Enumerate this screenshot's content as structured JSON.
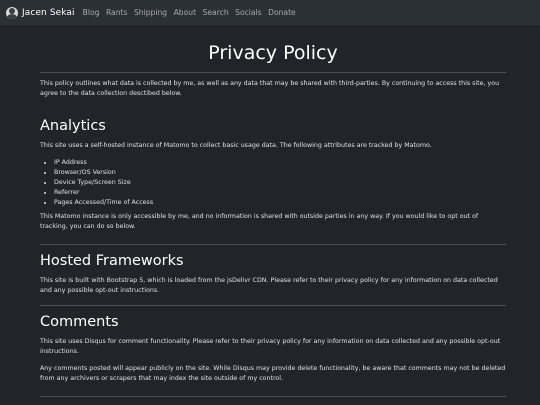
{
  "nav": {
    "brand": "Jacen Sekai",
    "links": [
      "Blog",
      "Rants",
      "Shipping",
      "About",
      "Search",
      "Socials",
      "Donate"
    ]
  },
  "page": {
    "title": "Privacy Policy",
    "intro": "This policy outlines what data is collected by me, as well as any data that may be shared with third-parties. By continuing to access this site, you agree to the data collection desctibed below."
  },
  "analytics": {
    "heading": "Analytics",
    "text": "This site uses a self-hosted instance of Matomo to collect basic usage data. The following attributes are tracked by Matomo.",
    "items": [
      "IP Address",
      "Browser/OS Version",
      "Device Type/Screen Size",
      "Referrer",
      "Pages Accessed/Time of Access"
    ],
    "note": "This Matomo instance is only accessible by me, and no information is shared with outside parties in any way. If you would like to opt out of tracking, you can do so below."
  },
  "frameworks": {
    "heading": "Hosted Frameworks",
    "text": "This site is built with Bootstrap 5, which is loaded from the jsDelivr CDN. Please refer to their privacy policy for any information on data collected and any possible opt-out instructions."
  },
  "comments": {
    "heading": "Comments",
    "text1": "This site uses Disqus for comment functionality. Please refer to their privacy policy for any information on data collected and any possible opt-out instructions.",
    "text2": "Any comments posted will appear publicly on the site. While Disqus may provide delete functionality, be aware that comments may not be deleted from any archivers or scrapers that may index the site outside of my control."
  }
}
